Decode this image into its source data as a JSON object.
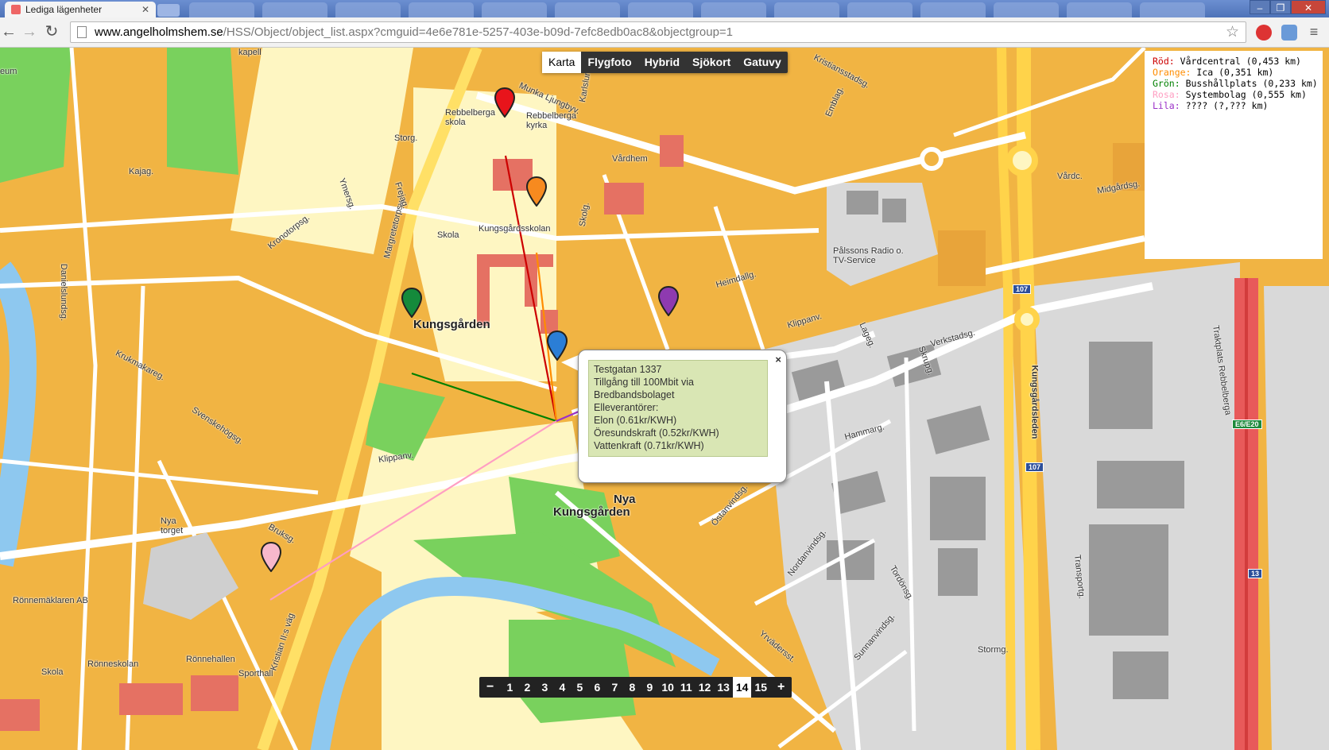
{
  "browser": {
    "tab_title": "Lediga lägenheter",
    "url_domain": "www.angelholmshem.se",
    "url_path": "/HSS/Object/object_list.aspx?cmguid=4e6e781e-5257-403e-b09d-7efc8edb0ac8&objectgroup=1"
  },
  "map_types": [
    "Karta",
    "Flygfoto",
    "Hybrid",
    "Sjökort",
    "Gatuvy"
  ],
  "active_map_type": "Karta",
  "legend": [
    {
      "color_name": "Röd:",
      "text": "Vårdcentral (0,453 km)",
      "color": "#cc0000"
    },
    {
      "color_name": "Orange:",
      "text": "Ica (0,351 km)",
      "color": "#ff8c00"
    },
    {
      "color_name": "Grön:",
      "text": "Busshållplats (0,233 km)",
      "color": "#008000"
    },
    {
      "color_name": "Rosa:",
      "text": "Systembolag (0,555 km)",
      "color": "#ff9ec2"
    },
    {
      "color_name": "Lila:",
      "text": "???? (?,??? km)",
      "color": "#9b30c8"
    }
  ],
  "info_window": {
    "lines": [
      "Testgatan 1337",
      "Tillgång till 100Mbit via",
      "Bredbandsbolaget",
      "Elleverantörer:",
      "Elon (0.61kr/KWH)",
      "Öresundskraft (0.52kr/KWH)",
      "Vattenkraft (0.71kr/KWH)"
    ],
    "close_glyph": "×"
  },
  "zoom": {
    "minus": "−",
    "plus": "+",
    "levels": [
      "1",
      "2",
      "3",
      "4",
      "5",
      "6",
      "7",
      "8",
      "9",
      "10",
      "11",
      "12",
      "13",
      "14",
      "15"
    ],
    "active": "14"
  },
  "map_labels": {
    "kungsgarden": "Kungsgården",
    "nya": "Nya",
    "nya_kungsgarden": "Kungsgården",
    "rebbelberga_skola": "Rebbelberga skola",
    "rebbelberga_kyrka": "Rebbelberga kyrka",
    "skola": "Skola",
    "kungsgardsskolan": "Kungsgårdsskolan",
    "vardhem": "Vårdhem",
    "palssons": "Pålssons Radio o. TV-Service",
    "nya_torget": "Nya torget",
    "ronnemaklaren": "Rönnemäklaren AB",
    "ronneskolan": "Rönneskolan",
    "ronnehallen": "Rönnehallen",
    "sporthall": "Sporthall",
    "skola2": "Skola",
    "vardc": "Vårdc.",
    "kapell": "kapell",
    "museum": "eum"
  },
  "road_labels": [
    "Margretetorpsv.",
    "Munka Ljungbyv.",
    "Storg.",
    "Kajag.",
    "Heimdallg.",
    "Klippanv.",
    "Kungsgårdsleden",
    "Verkstadsg.",
    "Hammarg.",
    "Östanvindsg.",
    "Nordanvindsg.",
    "Kristian II:s väg",
    "Bruksg.",
    "Danielslundsg.",
    "Kristiansstadsg.",
    "Midgårdsg.",
    "Traktplats Rebbelberga",
    "Tordönsg.",
    "Yrvädersst.",
    "Sunnanvindsg.",
    "Stormg.",
    "Transportg.",
    "Skrupg.",
    "Lageg.",
    "Emblag.",
    "Klippanv.",
    "Svenskehögsg.",
    "Krukmakareg.",
    "Ymersg.",
    "Frejag.",
    "Kronotorpsg.",
    "Karlslund",
    "Skolg."
  ],
  "route_shields": [
    "107",
    "107",
    "13",
    "E6/E20"
  ],
  "markers": [
    {
      "name": "Vårdcentral",
      "color": "#e8141b"
    },
    {
      "name": "Ica",
      "color": "#f78a1f"
    },
    {
      "name": "Busshållplats",
      "color": "#148a3b"
    },
    {
      "name": "Systembolag",
      "color": "#f7b8cc"
    },
    {
      "name": "Lila",
      "color": "#8e3ab0"
    },
    {
      "name": "Bostad",
      "color": "#2b7ed6"
    }
  ]
}
